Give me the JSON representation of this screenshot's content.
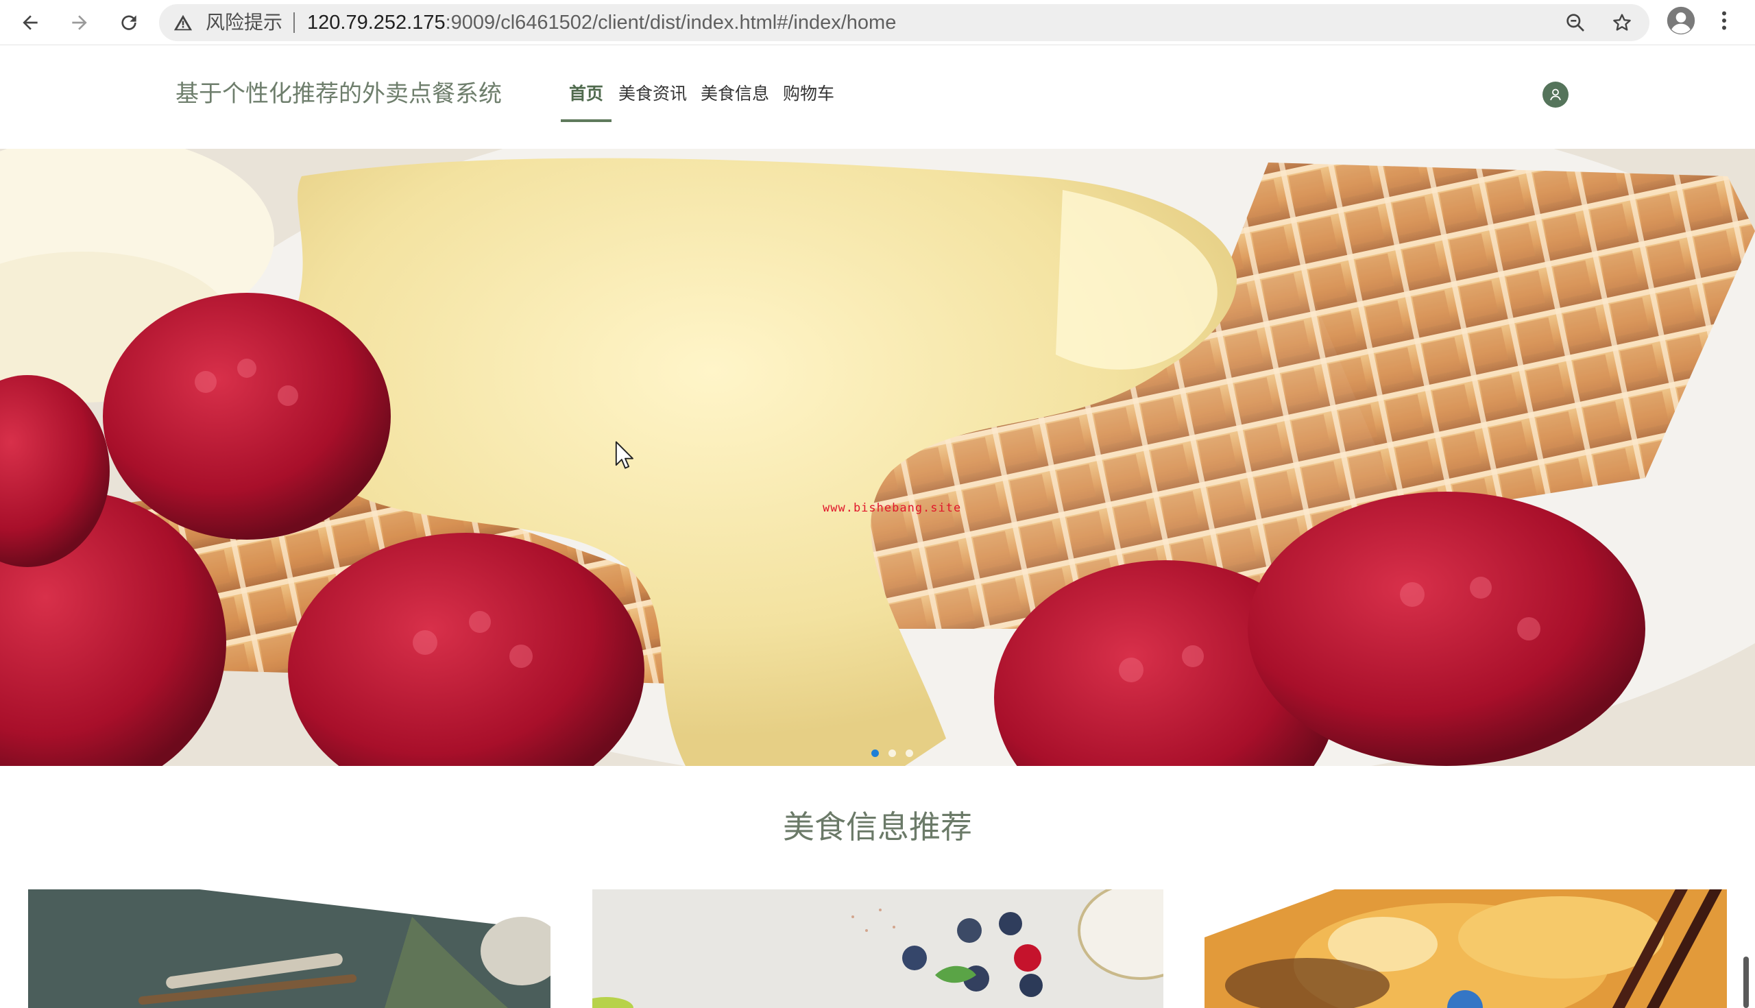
{
  "browser": {
    "risk_label": "风险提示",
    "url_host": "120.79.252.175",
    "url_rest": ":9009/cl6461502/client/dist/index.html#/index/home"
  },
  "header": {
    "site_title": "基于个性化推荐的外卖点餐系统",
    "nav": [
      {
        "label": "首页",
        "active": true
      },
      {
        "label": "美食资讯",
        "active": false
      },
      {
        "label": "美食信息",
        "active": false
      },
      {
        "label": "购物车",
        "active": false
      }
    ]
  },
  "hero": {
    "watermark": "www.bishebang.site",
    "slides_total": 3,
    "active_slide": 1
  },
  "recommend": {
    "title": "美食信息推荐"
  },
  "colors": {
    "accent_green": "#5f7a5c",
    "title_green": "#6e7e6c",
    "dot_active": "#1e7fd6",
    "watermark_red": "#e0162b"
  }
}
